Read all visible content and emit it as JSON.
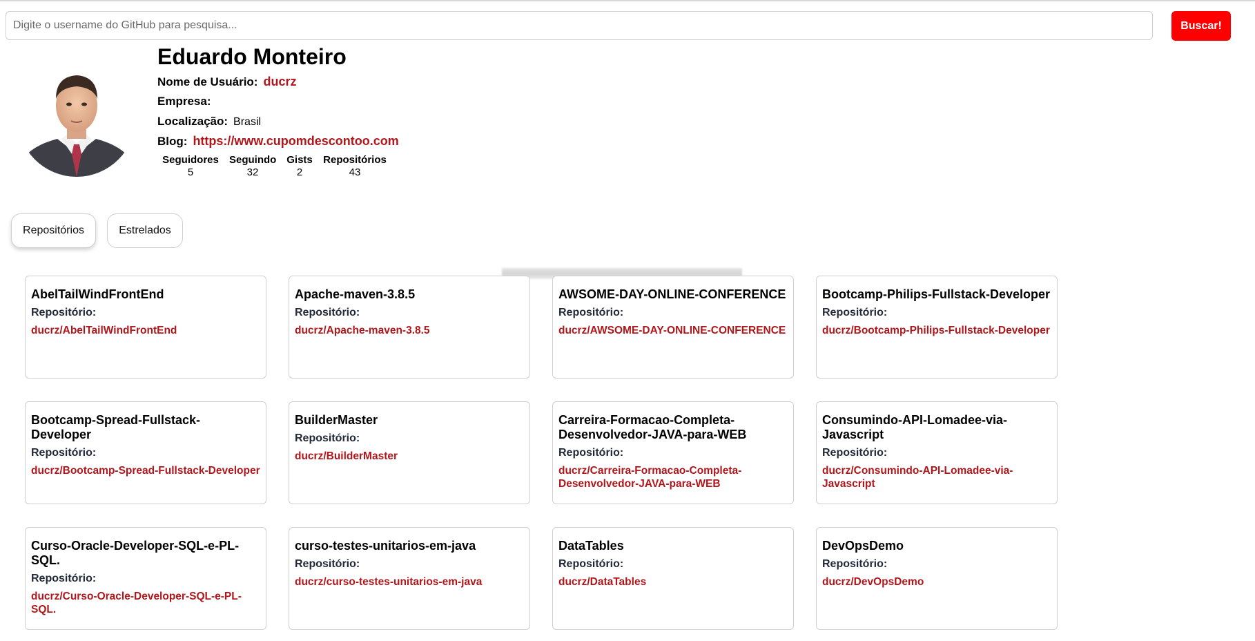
{
  "search": {
    "placeholder": "Digite o username do GitHub para pesquisa...",
    "button_label": "Buscar!"
  },
  "profile": {
    "name": "Eduardo Monteiro",
    "username_label": "Nome de Usuário:",
    "username": "ducrz",
    "company_label": "Empresa:",
    "company": "",
    "location_label": "Localização:",
    "location": "Brasil",
    "blog_label": "Blog:",
    "blog": "https://www.cupomdescontoo.com",
    "stats": [
      {
        "label": "Seguidores",
        "value": "5"
      },
      {
        "label": "Seguindo",
        "value": "32"
      },
      {
        "label": "Gists",
        "value": "2"
      },
      {
        "label": "Repositórios",
        "value": "43"
      }
    ]
  },
  "tabs": [
    {
      "label": "Repositórios",
      "active": true
    },
    {
      "label": "Estrelados",
      "active": false
    }
  ],
  "repo_label": "Repositório:",
  "repos": [
    {
      "name": "AbelTailWindFrontEnd",
      "full_name": "ducrz/AbelTailWindFrontEnd"
    },
    {
      "name": "Apache-maven-3.8.5",
      "full_name": "ducrz/Apache-maven-3.8.5"
    },
    {
      "name": "AWSOME-DAY-ONLINE-CONFERENCE",
      "full_name": "ducrz/AWSOME-DAY-ONLINE-CONFERENCE"
    },
    {
      "name": "Bootcamp-Philips-Fullstack-Developer",
      "full_name": "ducrz/Bootcamp-Philips-Fullstack-Developer"
    },
    {
      "name": "Bootcamp-Spread-Fullstack-Developer",
      "full_name": "ducrz/Bootcamp-Spread-Fullstack-Developer"
    },
    {
      "name": "BuilderMaster",
      "full_name": "ducrz/BuilderMaster"
    },
    {
      "name": "Carreira-Formacao-Completa-Desenvolvedor-JAVA-para-WEB",
      "full_name": "ducrz/Carreira-Formacao-Completa-Desenvolvedor-JAVA-para-WEB"
    },
    {
      "name": "Consumindo-API-Lomadee-via-Javascript",
      "full_name": "ducrz/Consumindo-API-Lomadee-via-Javascript"
    },
    {
      "name": "Curso-Oracle-Developer-SQL-e-PL-SQL.",
      "full_name": "ducrz/Curso-Oracle-Developer-SQL-e-PL-SQL."
    },
    {
      "name": "curso-testes-unitarios-em-java",
      "full_name": "ducrz/curso-testes-unitarios-em-java"
    },
    {
      "name": "DataTables",
      "full_name": "ducrz/DataTables"
    },
    {
      "name": "DevOpsDemo",
      "full_name": "ducrz/DevOpsDemo"
    }
  ],
  "colors": {
    "accent": "#ff0000",
    "link": "#b0161a"
  },
  "icons": {
    "avatar": "user-photo"
  }
}
